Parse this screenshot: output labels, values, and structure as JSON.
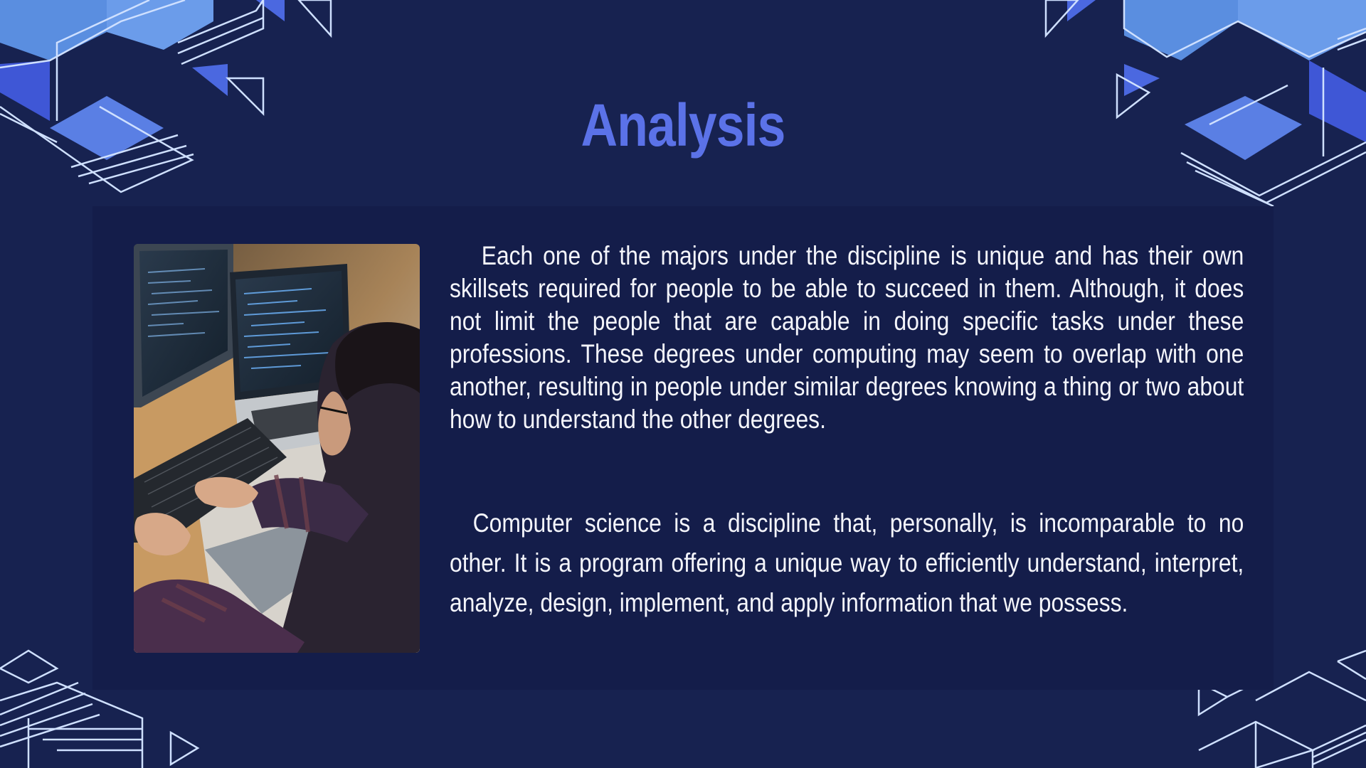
{
  "slide": {
    "title": "Analysis",
    "paragraphs": [
      "Each one of the majors under the discipline is unique and has their own skillsets required for people to be able to succeed in them. Although, it does not limit the people that are capable in doing specific tasks under these professions. These degrees under computing may seem to overlap with one another, resulting in people under similar degrees knowing a thing or two about how to understand the other degrees.",
      "Computer science is a discipline that, personally, is incomparable to no other. It is a program offering a unique way to efficiently understand, interpret, analyze, design, implement, and apply information that we possess."
    ],
    "image": {
      "icon": "photo-person-coding-laptop"
    }
  },
  "colors": {
    "background": "#172250",
    "panel": "#141d4a",
    "title": "#5b72e8",
    "text": "#f4f5fb",
    "accent_light": "#6f9be6",
    "accent_dark": "#3f57d6",
    "line": "#cfe0ff"
  }
}
